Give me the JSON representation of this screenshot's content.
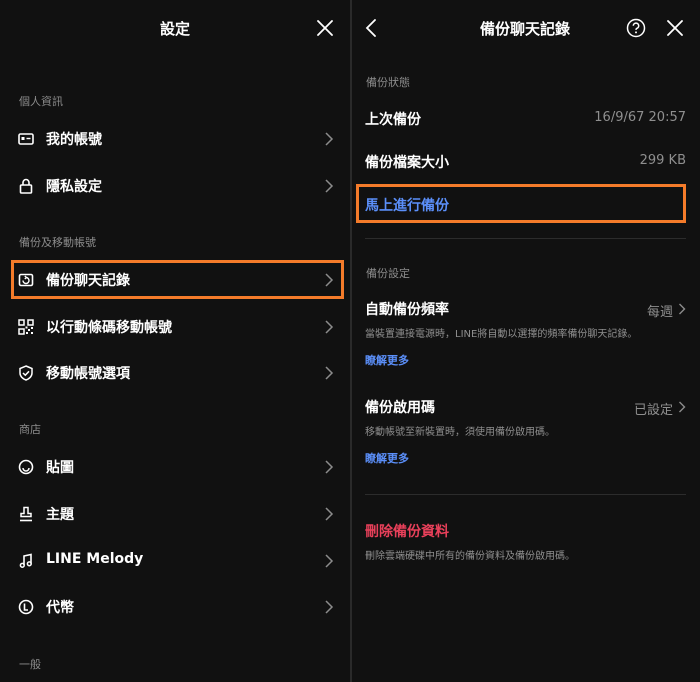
{
  "left": {
    "title": "設定",
    "sections": {
      "personal": "個人資訊",
      "backup": "備份及移動帳號",
      "store": "商店",
      "general": "一般"
    },
    "items": {
      "account": "我的帳號",
      "privacy": "隱私設定",
      "backup_chat": "備份聊天記錄",
      "qr_transfer": "以行動條碼移動帳號",
      "transfer_options": "移動帳號選項",
      "stickers": "貼圖",
      "themes": "主題",
      "line_melody": "LINE Melody",
      "coins": "代幣"
    }
  },
  "right": {
    "title": "備份聊天記錄",
    "status_section": "備份狀態",
    "last_backup_label": "上次備份",
    "last_backup_value": "16/9/67 20:57",
    "file_size_label": "備份檔案大小",
    "file_size_value": "299 KB",
    "backup_now": "馬上進行備份",
    "settings_section": "備份設定",
    "auto_freq_label": "自動備份頻率",
    "auto_freq_value": "每週",
    "auto_freq_desc": "當裝置連接電源時，LINE將自動以選擇的頻率備份聊天記錄。",
    "learn_more_1": "瞭解更多",
    "pin_label": "備份啟用碼",
    "pin_value": "已設定",
    "pin_desc": "移動帳號至新裝置時，須使用備份啟用碼。",
    "learn_more_2": "瞭解更多",
    "delete_label": "刪除備份資料",
    "delete_desc": "刪除雲端硬碟中所有的備份資料及備份啟用碼。"
  },
  "colors": {
    "highlight": "#f47b2a",
    "link": "#5b8ff9",
    "danger": "#e8405a"
  }
}
